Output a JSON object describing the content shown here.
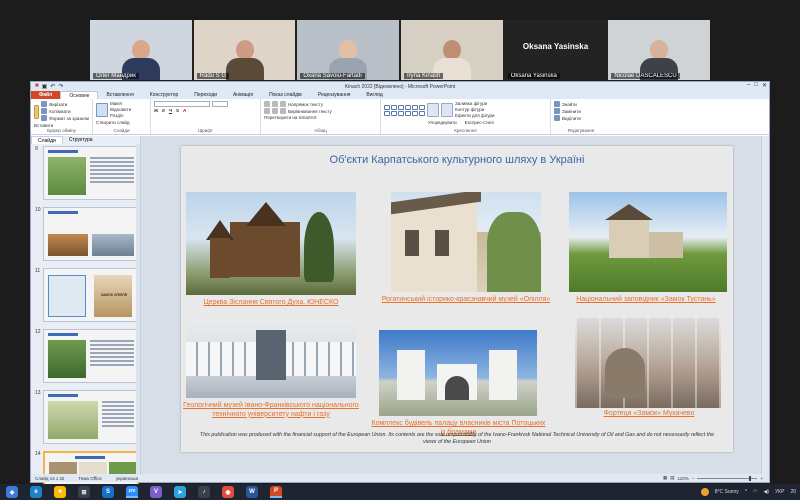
{
  "participants": [
    {
      "name": "Олег Мандрик",
      "color": "#3b4a6a"
    },
    {
      "name": "Radu S G",
      "color": "#6a5a4a"
    },
    {
      "name": "Oxana Savoiu-Fartadi",
      "color": "#c9c9c9"
    },
    {
      "name": "Iryna Kinash",
      "color": "#8a6f5a"
    },
    {
      "name": "Oksana Yasinska",
      "color": "#232323"
    },
    {
      "name": "Nicolae DASCALESCU",
      "color": "#6b6f74"
    }
  ],
  "center_tile_label": "Oksana Yasinska",
  "window": {
    "title": "Kinach 2022 [Відновлено] - Microsoft PowerPoint"
  },
  "ribbon_tabs": [
    "Файл",
    "Основне",
    "Вставлення",
    "Конструктор",
    "Переходи",
    "Анімація",
    "Показ слайдів",
    "Рецензування",
    "Вигляд"
  ],
  "ribbon": {
    "paste": "Вставити",
    "cut": "Вирізати",
    "copy": "Копіювати",
    "format_painter": "Формат за зразком",
    "clipboard_group": "Буфер обміну",
    "new_slide": "Створити слайд",
    "layout": "Макет",
    "reset": "Відновити",
    "section": "Розділ",
    "slides_group": "Слайди",
    "font_group": "Шрифт",
    "paragraph_group": "Абзац",
    "text_direction": "Напрямок тексту",
    "align_text": "Вирівнювання тексту",
    "convert_smartart": "Перетворити на SmartArt",
    "arrange": "Упорядкувати",
    "quick_styles": "Експрес-стилі",
    "shape_fill": "Заливка фігури",
    "shape_outline": "Контур фігури",
    "shape_effects": "Ефекти для фігури",
    "drawing_group": "Креслення",
    "find": "Знайти",
    "replace": "Замінити",
    "select": "Виділити",
    "editing_group": "Редагування"
  },
  "panel_tabs": [
    "Слайди",
    "Структура"
  ],
  "thumbnails": [
    9,
    10,
    11,
    12,
    13,
    14
  ],
  "thumb_label": "ЗАМОК ОПІЛЛЯ",
  "slide": {
    "title": "Об'єкти Карпатського культурного шляху в Україні",
    "items": [
      {
        "caption": "Церква Зіслання Святого Духа. ЮНЕСКО"
      },
      {
        "caption": "Рогатинський історико-краєзнавчий музей «Опілля»"
      },
      {
        "caption": "Національний заповідник «Замок Тустань»"
      },
      {
        "caption": "Геологічний музей Івано-Франківського національного технічного університету нафти і газу"
      },
      {
        "caption": "Комплекс будівель палацу власників міста Потоцьких із брамами"
      },
      {
        "caption": "Фортеця «Замок» Мукачево"
      }
    ],
    "footnote": "This publication was  produced with  the financial support of the European Union. Its contents are the sole responsibility of the Ivano-Frankivsk National Technical University of Oil and Gas and do not necessarily reflect the views  of the European Union"
  },
  "status": {
    "slide": "Слайд 14 з 32",
    "theme": "Тема Office",
    "language": "українська",
    "zoom": "110%"
  },
  "taskbar": {
    "apps": [
      {
        "label": "◆",
        "color": "#3d7bd6"
      },
      {
        "label": "e",
        "color": "#1b84c9"
      },
      {
        "label": "■",
        "color": "#ffb900"
      },
      {
        "label": "⊞",
        "color": "#3a3f4a"
      },
      {
        "label": "S",
        "color": "#1570c9"
      },
      {
        "label": "zm",
        "color": "#2d8cff"
      },
      {
        "label": "V",
        "color": "#7d5fc9"
      },
      {
        "label": "➤",
        "color": "#2aa3df"
      },
      {
        "label": "♪",
        "color": "#3a3f4a"
      },
      {
        "label": "◉",
        "color": "#e04b3a"
      },
      {
        "label": "W",
        "color": "#2b5797"
      },
      {
        "label": "P",
        "color": "#d24726"
      }
    ],
    "weather": "8°C  Sunny",
    "lang": "УКР",
    "time": "20"
  }
}
